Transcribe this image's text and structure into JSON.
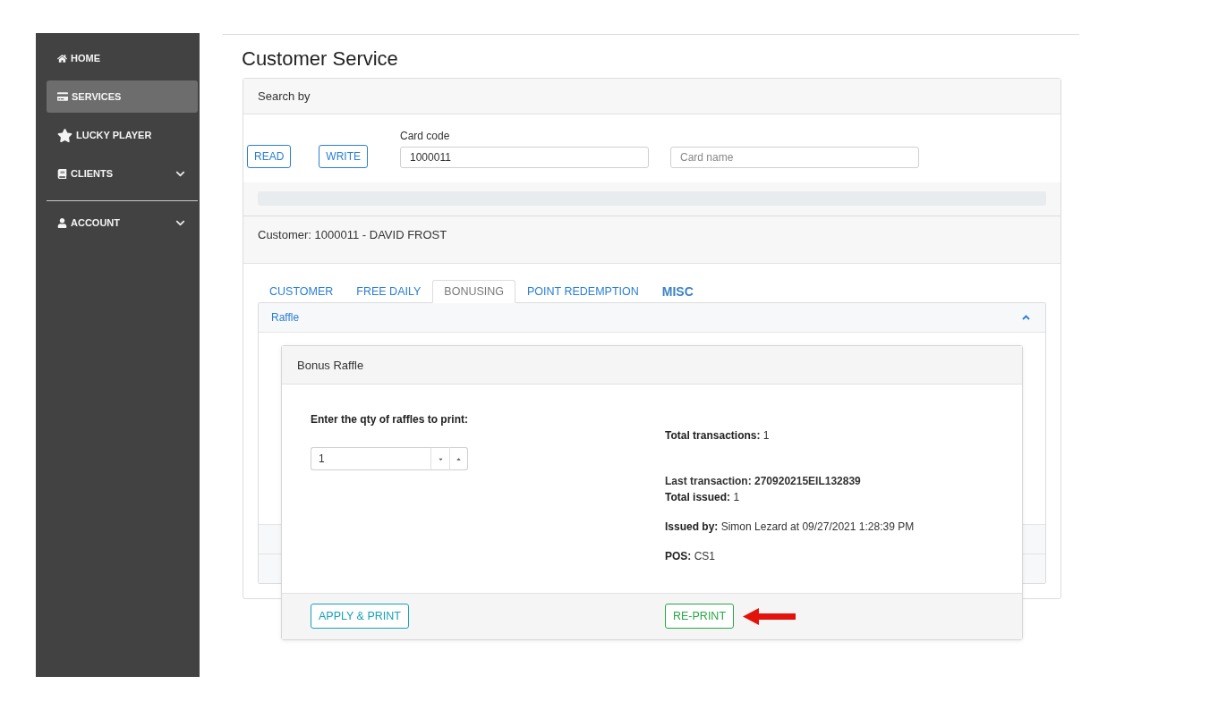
{
  "sidebar": {
    "groups": [
      [
        {
          "label": "HOME",
          "selected": false,
          "kind": "link"
        },
        {
          "label": "SERVICES",
          "selected": true,
          "kind": "link"
        },
        {
          "label": "LUCKY PLAYER",
          "selected": false,
          "kind": "link"
        },
        {
          "label": "CLIENTS",
          "selected": false,
          "kind": "menu"
        }
      ],
      [
        {
          "label": "ACCOUNT",
          "selected": false,
          "kind": "menu"
        }
      ]
    ]
  },
  "page": {
    "title": "Customer Service"
  },
  "search_card": {
    "header": "Search by",
    "buttons": [
      "READ",
      "WRITE"
    ],
    "fields": [
      {
        "label": "Card code",
        "value": "1000011"
      },
      {
        "placeholder": "Card name"
      }
    ],
    "progress": {
      "level": 0
    }
  },
  "customer_card": {
    "header": "Customer: 1000011 - DAVID FROST",
    "tabs": [
      {
        "label": "CUSTOMER",
        "selected": false,
        "bold": false
      },
      {
        "label": "FREE DAILY",
        "selected": false,
        "bold": false
      },
      {
        "label": "BONUSING",
        "selected": true,
        "bold": false
      },
      {
        "label": "POINT REDEMPTION",
        "selected": false,
        "bold": false
      },
      {
        "label": "MISC",
        "selected": false,
        "bold": true
      }
    ],
    "accordion": {
      "title": "Raffle",
      "expanded": true
    }
  },
  "modal": {
    "title": "Bonus Raffle",
    "qty_label": "Enter the qty of raffles to print:",
    "qty_value": "1",
    "info_groups": [
      [
        {
          "text": "**Total transactions:** 1",
          "bold": false
        }
      ],
      [
        {
          "text": "Last transaction: 270920215EIL132839",
          "bold": true
        },
        {
          "text": "**Total issued:** 1",
          "bold": false
        }
      ],
      [
        {
          "text": "**Issued by:** Simon Lezard at 09/27/2021 1:28:39 PM",
          "bold": false
        }
      ],
      [
        {
          "text": "**POS:** CS1",
          "bold": false
        }
      ]
    ],
    "buttons": [
      {
        "label": "APPLY & PRINT",
        "kind": "info"
      },
      {
        "label": "RE-PRINT",
        "kind": "success"
      }
    ]
  }
}
